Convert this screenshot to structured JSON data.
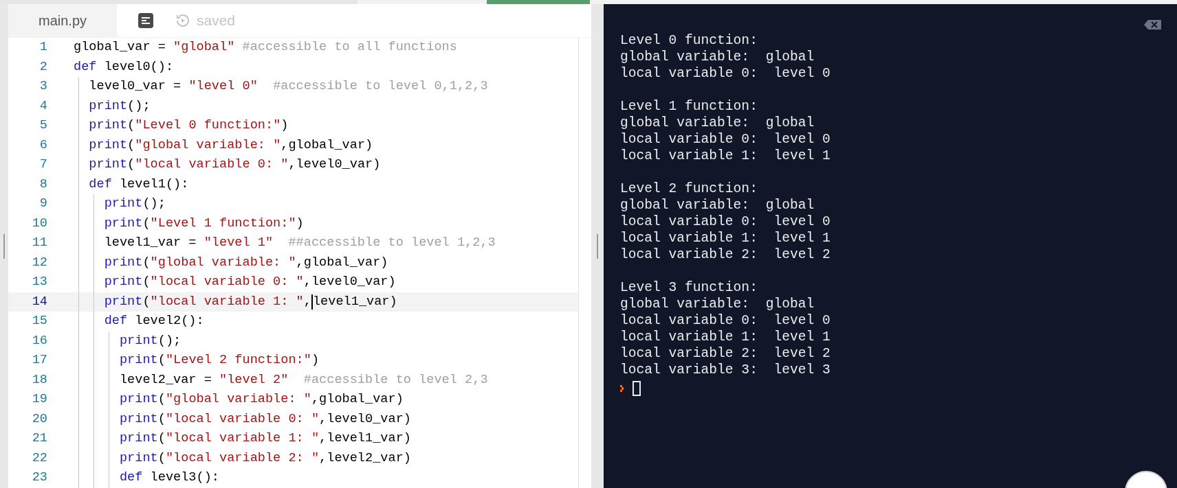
{
  "editor": {
    "tab": {
      "label": "main.py",
      "selected": true
    },
    "status": "saved",
    "lines": [
      {
        "number": "1",
        "current": false,
        "tokens": [
          {
            "kind": "plain",
            "text": "global_var = "
          },
          {
            "kind": "string",
            "text": "\"global\""
          },
          {
            "kind": "comment",
            "text": " #accessible to all functions"
          }
        ]
      },
      {
        "number": "2",
        "current": false,
        "tokens": [
          {
            "kind": "keyword",
            "text": "def"
          },
          {
            "kind": "plain",
            "text": " level0():"
          }
        ]
      },
      {
        "number": "3",
        "current": false,
        "tokens": [
          {
            "kind": "indent"
          },
          {
            "kind": "plain",
            "text": "level0_var = "
          },
          {
            "kind": "string",
            "text": "\"level 0\""
          },
          {
            "kind": "comment",
            "text": "  #accessible to level 0,1,2,3"
          }
        ]
      },
      {
        "number": "4",
        "current": false,
        "tokens": [
          {
            "kind": "indent"
          },
          {
            "kind": "keyword",
            "text": "print"
          },
          {
            "kind": "plain",
            "text": "();"
          }
        ]
      },
      {
        "number": "5",
        "current": false,
        "tokens": [
          {
            "kind": "indent"
          },
          {
            "kind": "keyword",
            "text": "print"
          },
          {
            "kind": "plain",
            "text": "("
          },
          {
            "kind": "string",
            "text": "\"Level 0 function:\""
          },
          {
            "kind": "plain",
            "text": ")"
          }
        ]
      },
      {
        "number": "6",
        "current": false,
        "tokens": [
          {
            "kind": "indent"
          },
          {
            "kind": "keyword",
            "text": "print"
          },
          {
            "kind": "plain",
            "text": "("
          },
          {
            "kind": "string",
            "text": "\"global variable: \""
          },
          {
            "kind": "plain",
            "text": ",global_var)"
          }
        ]
      },
      {
        "number": "7",
        "current": false,
        "tokens": [
          {
            "kind": "indent"
          },
          {
            "kind": "keyword",
            "text": "print"
          },
          {
            "kind": "plain",
            "text": "("
          },
          {
            "kind": "string",
            "text": "\"local variable 0: \""
          },
          {
            "kind": "plain",
            "text": ",level0_var)"
          }
        ]
      },
      {
        "number": "8",
        "current": false,
        "tokens": [
          {
            "kind": "indent"
          },
          {
            "kind": "keyword",
            "text": "def"
          },
          {
            "kind": "plain",
            "text": " level1():"
          }
        ]
      },
      {
        "number": "9",
        "current": false,
        "tokens": [
          {
            "kind": "indent"
          },
          {
            "kind": "indent"
          },
          {
            "kind": "keyword",
            "text": "print"
          },
          {
            "kind": "plain",
            "text": "();"
          }
        ]
      },
      {
        "number": "10",
        "current": false,
        "tokens": [
          {
            "kind": "indent"
          },
          {
            "kind": "indent"
          },
          {
            "kind": "keyword",
            "text": "print"
          },
          {
            "kind": "plain",
            "text": "("
          },
          {
            "kind": "string",
            "text": "\"Level 1 function:\""
          },
          {
            "kind": "plain",
            "text": ")"
          }
        ]
      },
      {
        "number": "11",
        "current": false,
        "tokens": [
          {
            "kind": "indent"
          },
          {
            "kind": "indent"
          },
          {
            "kind": "plain",
            "text": "level1_var = "
          },
          {
            "kind": "string",
            "text": "\"level 1\""
          },
          {
            "kind": "comment",
            "text": "  ##accessible to level 1,2,3"
          }
        ]
      },
      {
        "number": "12",
        "current": false,
        "tokens": [
          {
            "kind": "indent"
          },
          {
            "kind": "indent"
          },
          {
            "kind": "keyword",
            "text": "print"
          },
          {
            "kind": "plain",
            "text": "("
          },
          {
            "kind": "string",
            "text": "\"global variable: \""
          },
          {
            "kind": "plain",
            "text": ",global_var)"
          }
        ]
      },
      {
        "number": "13",
        "current": false,
        "tokens": [
          {
            "kind": "indent"
          },
          {
            "kind": "indent"
          },
          {
            "kind": "keyword",
            "text": "print"
          },
          {
            "kind": "plain",
            "text": "("
          },
          {
            "kind": "string",
            "text": "\"local variable 0: \""
          },
          {
            "kind": "plain",
            "text": ",level0_var)"
          }
        ]
      },
      {
        "number": "14",
        "current": true,
        "tokens": [
          {
            "kind": "indent"
          },
          {
            "kind": "indent"
          },
          {
            "kind": "keyword",
            "text": "print"
          },
          {
            "kind": "plain",
            "text": "("
          },
          {
            "kind": "string",
            "text": "\"local variable 1: \""
          },
          {
            "kind": "plain",
            "text": ","
          },
          {
            "kind": "cursor"
          },
          {
            "kind": "plain",
            "text": "level1_var)"
          }
        ]
      },
      {
        "number": "15",
        "current": false,
        "tokens": [
          {
            "kind": "indent"
          },
          {
            "kind": "indent"
          },
          {
            "kind": "keyword",
            "text": "def"
          },
          {
            "kind": "plain",
            "text": " level2():"
          }
        ]
      },
      {
        "number": "16",
        "current": false,
        "tokens": [
          {
            "kind": "indent"
          },
          {
            "kind": "indent"
          },
          {
            "kind": "indent"
          },
          {
            "kind": "keyword",
            "text": "print"
          },
          {
            "kind": "plain",
            "text": "();"
          }
        ]
      },
      {
        "number": "17",
        "current": false,
        "tokens": [
          {
            "kind": "indent"
          },
          {
            "kind": "indent"
          },
          {
            "kind": "indent"
          },
          {
            "kind": "keyword",
            "text": "print"
          },
          {
            "kind": "plain",
            "text": "("
          },
          {
            "kind": "string",
            "text": "\"Level 2 function:\""
          },
          {
            "kind": "plain",
            "text": ")"
          }
        ]
      },
      {
        "number": "18",
        "current": false,
        "tokens": [
          {
            "kind": "indent"
          },
          {
            "kind": "indent"
          },
          {
            "kind": "indent"
          },
          {
            "kind": "plain",
            "text": "level2_var = "
          },
          {
            "kind": "string",
            "text": "\"level 2\""
          },
          {
            "kind": "comment",
            "text": "  #accessible to level 2,3"
          }
        ]
      },
      {
        "number": "19",
        "current": false,
        "tokens": [
          {
            "kind": "indent"
          },
          {
            "kind": "indent"
          },
          {
            "kind": "indent"
          },
          {
            "kind": "keyword",
            "text": "print"
          },
          {
            "kind": "plain",
            "text": "("
          },
          {
            "kind": "string",
            "text": "\"global variable: \""
          },
          {
            "kind": "plain",
            "text": ",global_var)"
          }
        ]
      },
      {
        "number": "20",
        "current": false,
        "tokens": [
          {
            "kind": "indent"
          },
          {
            "kind": "indent"
          },
          {
            "kind": "indent"
          },
          {
            "kind": "keyword",
            "text": "print"
          },
          {
            "kind": "plain",
            "text": "("
          },
          {
            "kind": "string",
            "text": "\"local variable 0: \""
          },
          {
            "kind": "plain",
            "text": ",level0_var)"
          }
        ]
      },
      {
        "number": "21",
        "current": false,
        "tokens": [
          {
            "kind": "indent"
          },
          {
            "kind": "indent"
          },
          {
            "kind": "indent"
          },
          {
            "kind": "keyword",
            "text": "print"
          },
          {
            "kind": "plain",
            "text": "("
          },
          {
            "kind": "string",
            "text": "\"local variable 1: \""
          },
          {
            "kind": "plain",
            "text": ",level1_var)"
          }
        ]
      },
      {
        "number": "22",
        "current": false,
        "tokens": [
          {
            "kind": "indent"
          },
          {
            "kind": "indent"
          },
          {
            "kind": "indent"
          },
          {
            "kind": "keyword",
            "text": "print"
          },
          {
            "kind": "plain",
            "text": "("
          },
          {
            "kind": "string",
            "text": "\"local variable 2: \""
          },
          {
            "kind": "plain",
            "text": ",level2_var)"
          }
        ]
      },
      {
        "number": "23",
        "current": false,
        "tokens": [
          {
            "kind": "indent"
          },
          {
            "kind": "indent"
          },
          {
            "kind": "indent"
          },
          {
            "kind": "keyword",
            "text": "def"
          },
          {
            "kind": "plain",
            "text": " level3():"
          }
        ]
      }
    ]
  },
  "console": {
    "blocks": [
      [
        "Level 0 function:",
        "global variable:  global",
        "local variable 0:  level 0"
      ],
      [
        "Level 1 function:",
        "global variable:  global",
        "local variable 0:  level 0",
        "local variable 1:  level 1"
      ],
      [
        "Level 2 function:",
        "global variable:  global",
        "local variable 0:  level 0",
        "local variable 1:  level 1",
        "local variable 2:  level 2"
      ],
      [
        "Level 3 function:",
        "global variable:  global",
        "local variable 0:  level 0",
        "local variable 1:  level 1",
        "local variable 2:  level 2",
        "local variable 3:  level 3"
      ]
    ]
  }
}
